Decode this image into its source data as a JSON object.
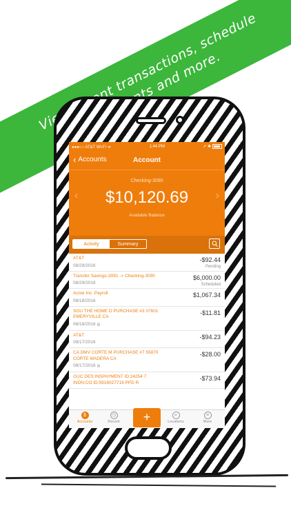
{
  "banner": {
    "line1": "View recent transactions, schedule",
    "line2": "payments and more."
  },
  "statusbar": {
    "carrier": "●●●○○ AT&T Wi-Fi ᯤ",
    "time": "1:44 PM",
    "indicators": "➚ ✱"
  },
  "nav": {
    "back_label": "Accounts",
    "title": "Account"
  },
  "account": {
    "name": "Checking-3090",
    "balance": "$10,120.69",
    "balance_label": "Available Balance",
    "prev_arrow": "‹",
    "next_arrow": "›"
  },
  "tabs": {
    "activity": "Activity",
    "summary": "Summary"
  },
  "transactions": [
    {
      "desc": "AT&T",
      "date": "08/29/2016",
      "amount": "-$92.44",
      "status": "Pending",
      "attachment": false
    },
    {
      "desc": "Transfer Savings-3091 -> Checking-3090",
      "date": "08/29/2016",
      "amount": "$6,000.00",
      "status": "Scheduled",
      "attachment": false
    },
    {
      "desc": "Acme Inc. Payroll",
      "date": "08/18/2016",
      "amount": "$1,067.34",
      "status": "",
      "attachment": false
    },
    {
      "desc": "SOU THE HOME D PURCHASE #3 07601 EMERYVILLE CA",
      "date": "08/18/2016",
      "amount": "-$11.81",
      "status": "",
      "attachment": true
    },
    {
      "desc": "AT&T",
      "date": "08/17/2016",
      "amount": "-$94.23",
      "status": "",
      "attachment": false
    },
    {
      "desc": "CA DMV CORTE M PURCHASE #7 55870 CORTE MADERA CA",
      "date": "08/17/2016",
      "amount": "-$28.00",
      "status": "",
      "attachment": true
    },
    {
      "desc": "GUC DES:INSPAYMENT ID:24254 7 INDN:CO ID:5916027719 PPD R",
      "date": "",
      "amount": "-$73.94",
      "status": "",
      "attachment": false
    }
  ],
  "tabbar": {
    "accounts": "Accounts",
    "recent": "Recent",
    "add": "+",
    "locations": "Locations",
    "more": "More"
  },
  "colors": {
    "accent": "#ef7d0b",
    "banner": "#3cb63b"
  }
}
